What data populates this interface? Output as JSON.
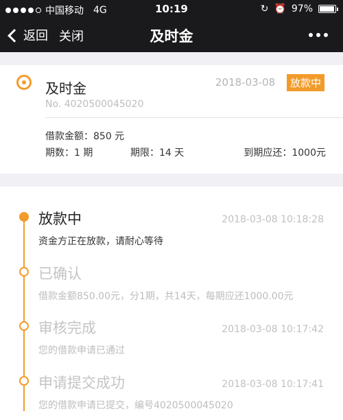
{
  "status_bar": {
    "carrier": "中国移动",
    "network": "4G",
    "time": "10:19",
    "battery_text": "97%",
    "battery_level": 0.97
  },
  "nav": {
    "back_label": "返回",
    "close_label": "关闭",
    "title": "及时金"
  },
  "loan": {
    "name": "及时金",
    "date": "2018-03-08",
    "status_badge": "放款中",
    "number": "No. 4020500045020",
    "amount": "借款金额：850 元",
    "periods": "期数：1 期",
    "term": "期限：14 天",
    "due": "到期应还：1000元"
  },
  "timeline": {
    "steps": [
      {
        "title": "放款中",
        "time": "2018-03-08 10:18:28",
        "desc": "资金方正在放款，请耐心等待"
      },
      {
        "title": "已确认",
        "time": "",
        "desc": "借款金额850.00元，分1期，共14天，每期应还1000.00元"
      },
      {
        "title": "审核完成",
        "time": "2018-03-08 10:17:42",
        "desc": "您的借款申请已通过"
      },
      {
        "title": "申请提交成功",
        "time": "2018-03-08 10:17:41",
        "desc": "您的借款申请已提交，编号4020500045020"
      }
    ]
  },
  "colors": {
    "accent": "#f39b2a",
    "bar": "#1a1a1d",
    "background": "#f1f0f5"
  }
}
